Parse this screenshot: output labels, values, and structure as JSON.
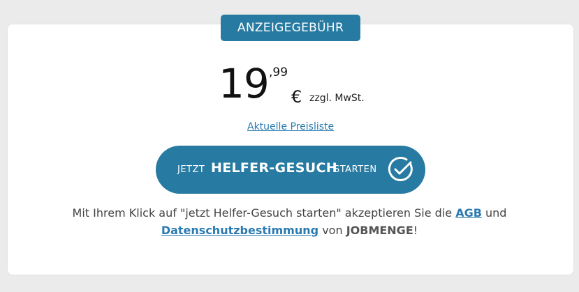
{
  "badge": {
    "label": "ANZEIGEGEBÜHR"
  },
  "price": {
    "integer": "19",
    "decimals": ",99",
    "currency": "€",
    "tax_note": "zzgl. MwSt."
  },
  "price_list_link": "Aktuelle Preisliste",
  "cta": {
    "prefix": "JETZT",
    "main": "HELFER-GESUCH",
    "suffix": "STARTEN",
    "icon": "check-circle-icon"
  },
  "terms": {
    "text_1": "Mit Ihrem Klick auf \"jetzt Helfer-Gesuch starten\" akzeptieren Sie die",
    "agb_link": "AGB",
    "text_2": "und",
    "privacy_link": "Datenschutzbestimmung",
    "text_3": "von",
    "brand": "JOBMENGE",
    "text_4": "!"
  },
  "colors": {
    "accent": "#277aa1",
    "link": "#2a7ab0",
    "background": "#ebebeb",
    "card": "#ffffff"
  }
}
